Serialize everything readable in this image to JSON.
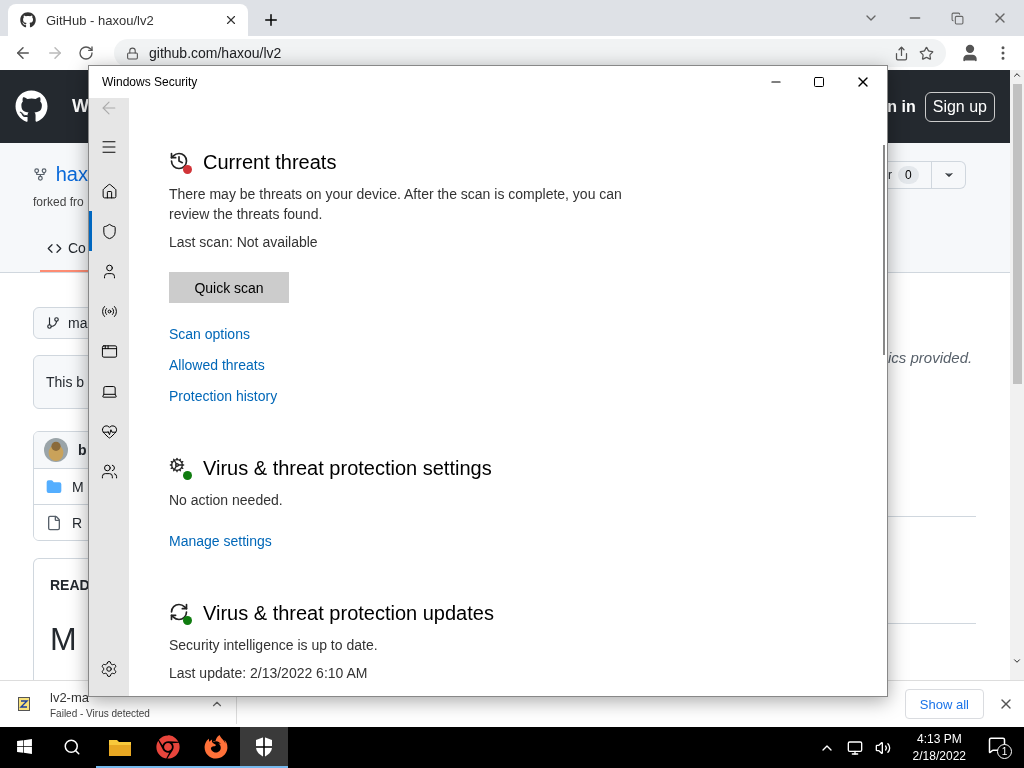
{
  "browser": {
    "tab_title": "GitHub - haxou/lv2",
    "url": "github.com/haxou/lv2"
  },
  "github": {
    "header_title": "W",
    "sign_in": "n in",
    "sign_up": "Sign up",
    "repo_name": "hax",
    "forked_from": "forked fro",
    "tabs": [
      {
        "label": "Co",
        "selected": true
      }
    ],
    "star_label": "r",
    "star_count": "0",
    "branch": "ma",
    "notice": "This b",
    "about": "ics provided.",
    "commit_author": "b",
    "files": [
      {
        "kind": "folder",
        "name": "M"
      },
      {
        "kind": "file",
        "name": "R"
      }
    ],
    "readme_label": "READ",
    "readme_title": "M"
  },
  "security": {
    "title": "Windows Security",
    "nav": [
      {
        "kind": "home",
        "selected": false
      },
      {
        "kind": "shield",
        "selected": true
      },
      {
        "kind": "account",
        "selected": false
      },
      {
        "kind": "network",
        "selected": false
      },
      {
        "kind": "app",
        "selected": false
      },
      {
        "kind": "device",
        "selected": false
      },
      {
        "kind": "health",
        "selected": false
      },
      {
        "kind": "family",
        "selected": false
      }
    ],
    "sections": [
      {
        "kind": "threats",
        "title": "Current threats",
        "paragraphs": [
          "There may be threats on your device. After the scan is complete, you can review the threats found.",
          "Last scan: Not available"
        ],
        "button": "Quick scan",
        "links": [
          "Scan options",
          "Allowed threats",
          "Protection history"
        ]
      },
      {
        "kind": "settings",
        "title": "Virus & threat protection settings",
        "paragraphs": [
          "No action needed."
        ],
        "links": [
          "Manage settings"
        ]
      },
      {
        "kind": "updates",
        "title": "Virus & threat protection updates",
        "paragraphs": [
          "Security intelligence is up to date.",
          "Last update: 2/13/2022 6:10 AM"
        ]
      }
    ]
  },
  "download": {
    "file": "lv2-ma",
    "status": "Failed - Virus detected",
    "show_all": "Show all"
  },
  "taskbar": {
    "apps": [
      {
        "kind": "explorer",
        "open": true,
        "selected": false
      },
      {
        "kind": "chrome",
        "open": true,
        "selected": false
      },
      {
        "kind": "firefox",
        "open": true,
        "selected": false
      },
      {
        "kind": "security",
        "open": true,
        "selected": true
      }
    ],
    "time": "4:13 PM",
    "date": "2/18/2022",
    "notifications": "1"
  }
}
